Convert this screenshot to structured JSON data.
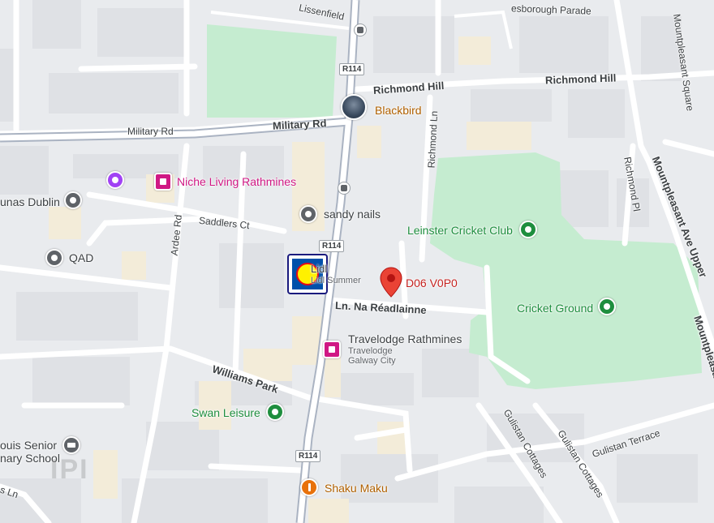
{
  "map": {
    "colors": {
      "background": "#e9ebee",
      "park": "#c5ecd0",
      "road": "#ffffff",
      "major_road": "#aab3c2",
      "building": "#f5f0e3",
      "pin_red": "#ea4335",
      "pin_green": "#1e8e3e",
      "pin_gray": "#5f6368",
      "pin_pink": "#d01884",
      "pin_orange": "#e8710a"
    },
    "roads": [
      {
        "id": "road-lissenfield",
        "label": "Lissenfield"
      },
      {
        "id": "road-parade",
        "label": "esborough Parade"
      },
      {
        "id": "road-mountpleasant-square",
        "label": "Mountpleasant Square"
      },
      {
        "id": "road-richmond-hill-1",
        "label": "Richmond Hill"
      },
      {
        "id": "road-richmond-hill-2",
        "label": "Richmond Hill"
      },
      {
        "id": "road-military-1",
        "label": "Military Rd"
      },
      {
        "id": "road-military-2",
        "label": "Military Rd"
      },
      {
        "id": "road-richmond-ln",
        "label": "Richmond Ln"
      },
      {
        "id": "road-richmond-pl",
        "label": "Richmond Pl"
      },
      {
        "id": "road-mountpleasant-ave",
        "label": "Mountpleasant Ave Upper"
      },
      {
        "id": "road-mountpleasant-edge",
        "label": "Mountpleasa"
      },
      {
        "id": "road-saddlers",
        "label": "Saddlers Ct"
      },
      {
        "id": "road-ardee",
        "label": "Ardee Rd"
      },
      {
        "id": "road-na-readlainne",
        "label": "Ln. Na Réadlainne"
      },
      {
        "id": "road-williams-park",
        "label": "Williams Park"
      },
      {
        "id": "road-gulistan-terrace",
        "label": "Gulistan Terrace"
      },
      {
        "id": "road-gulistan-cottages-1",
        "label": "Gulistan Cottages"
      },
      {
        "id": "road-gulistan-cottages-2",
        "label": "Gulistan Cottages"
      },
      {
        "id": "road-s-ln",
        "label": "s Ln"
      }
    ],
    "route_shields": [
      "R114",
      "R114",
      "R114"
    ],
    "places": [
      {
        "id": "blackbird",
        "label": "Blackbird",
        "icon": "photo-thumbnail",
        "color": "#b06000"
      },
      {
        "id": "niche-living",
        "label": "Niche Living Rathmines",
        "icon": "hotel-icon",
        "color": "#d01884"
      },
      {
        "id": "unas-dublin",
        "label": "unas Dublin",
        "icon": "place-icon",
        "color": "#3c4043"
      },
      {
        "id": "sandy-nails",
        "label": "sandy nails",
        "icon": "place-icon",
        "color": "#3c4043"
      },
      {
        "id": "leinster-cricket",
        "label": "Leinster Cricket Club",
        "icon": "park-icon",
        "color": "#1e8e3e"
      },
      {
        "id": "qad",
        "label": "QAD",
        "icon": "place-icon",
        "color": "#3c4043"
      },
      {
        "id": "lidl",
        "label": "Lidl",
        "sublabel": "Lidl Summer",
        "icon": "lidl-logo",
        "color": "#3c4043"
      },
      {
        "id": "d06",
        "label": "D06 V0P0",
        "icon": "red-pin-icon",
        "color": "#c5221f"
      },
      {
        "id": "cricket-ground",
        "label": "Cricket Ground",
        "icon": "park-icon",
        "color": "#1e8e3e"
      },
      {
        "id": "travelodge",
        "label": "Travelodge Rathmines",
        "sublabel": "Travelodge Galway City",
        "icon": "hotel-icon",
        "color": "#3c4043"
      },
      {
        "id": "swan-leisure",
        "label": "Swan Leisure",
        "icon": "park-icon",
        "color": "#1e8e3e"
      },
      {
        "id": "school",
        "label": "ouis Senior",
        "sublabel": "nary School",
        "icon": "school-icon",
        "color": "#3c4043"
      },
      {
        "id": "shaku-maku",
        "label": "Shaku Maku",
        "icon": "restaurant-icon",
        "color": "#b06000"
      }
    ],
    "watermark": "IPI"
  }
}
